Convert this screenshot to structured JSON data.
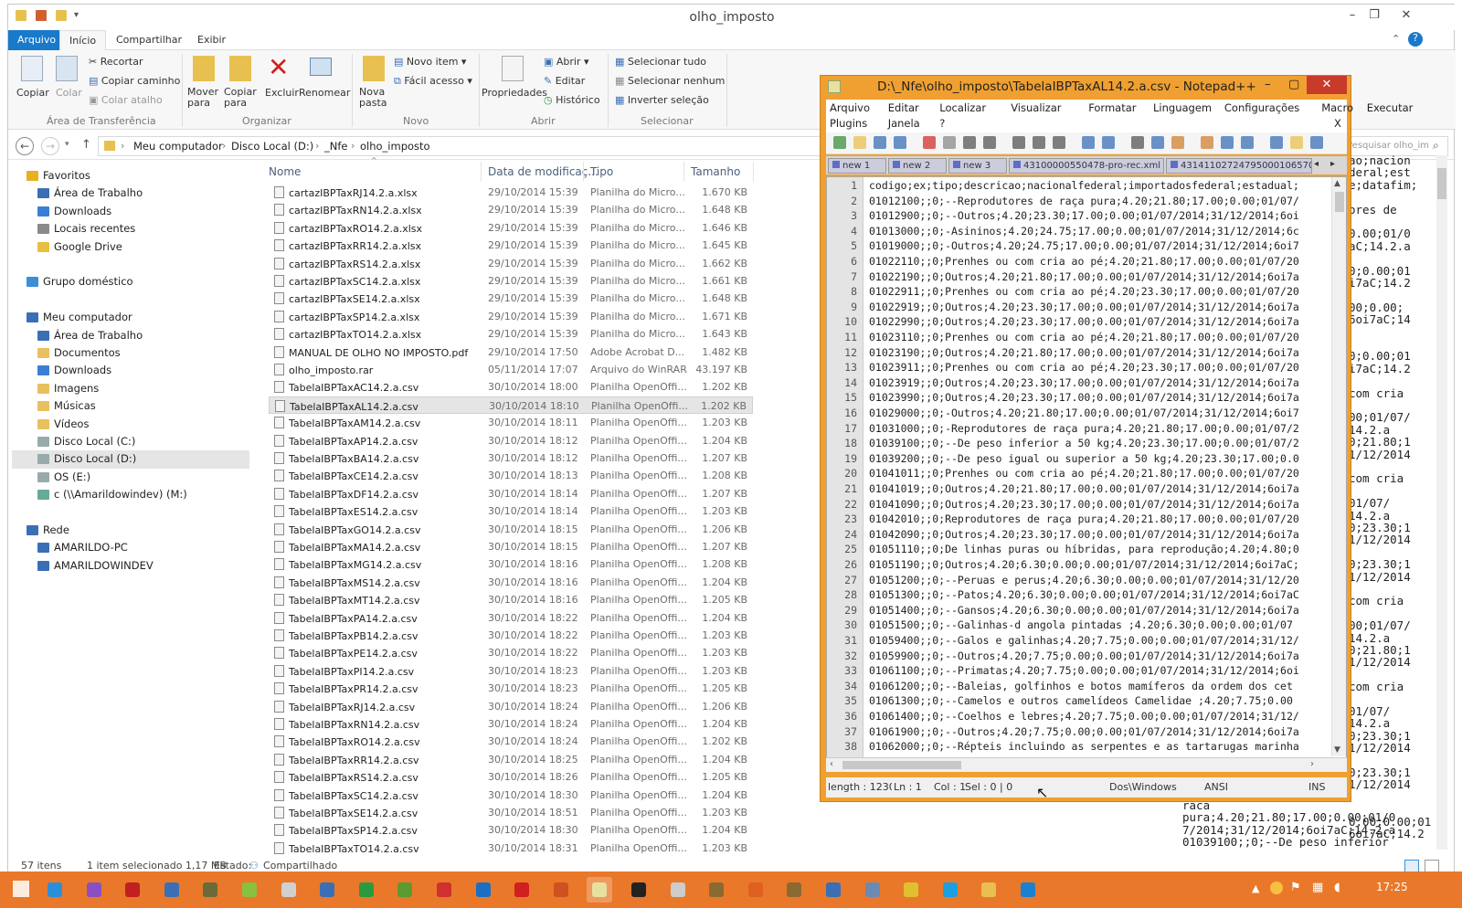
{
  "explorer": {
    "title": "olho_imposto",
    "tabs": [
      "Arquivo",
      "Início",
      "Compartilhar",
      "Exibir"
    ],
    "ribbon": {
      "clipboard": {
        "copiar": "Copiar",
        "colar": "Colar",
        "recortar": "Recortar",
        "copiar_caminho": "Copiar caminho",
        "colar_atalho": "Colar atalho",
        "group": "Área de Transferência"
      },
      "organizar": {
        "mover": "Mover para",
        "copiar_para": "Copiar para",
        "excluir": "Excluir",
        "renomear": "Renomear",
        "group": "Organizar"
      },
      "novo": {
        "nova_pasta": "Nova pasta",
        "novo_item": "Novo item ▾",
        "facil_acesso": "Fácil acesso ▾",
        "group": "Novo"
      },
      "abrir": {
        "propriedades": "Propriedades",
        "abrir": "Abrir ▾",
        "editar": "Editar",
        "historico": "Histórico",
        "group": "Abrir"
      },
      "selecionar": {
        "tudo": "Selecionar tudo",
        "nenhum": "Selecionar nenhum",
        "inverter": "Inverter seleção",
        "group": "Selecionar"
      }
    },
    "address": [
      "Meu computador",
      "Disco Local (D:)",
      "_Nfe",
      "olho_imposto"
    ],
    "search_placeholder": "Pesquisar olho_imposto",
    "nav": [
      {
        "label": "Favoritos",
        "indent": 0,
        "color": "#e8b020",
        "gap": false
      },
      {
        "label": "Área de Trabalho",
        "indent": 1,
        "color": "#3a6fb5",
        "gap": false
      },
      {
        "label": "Downloads",
        "indent": 1,
        "color": "#3a7fd5",
        "gap": false
      },
      {
        "label": "Locais recentes",
        "indent": 1,
        "color": "#8a8a8a",
        "gap": false
      },
      {
        "label": "Google Drive",
        "indent": 1,
        "color": "#e8c040",
        "gap": false
      },
      {
        "label": "Grupo doméstico",
        "indent": 0,
        "color": "#3a8fd5",
        "gap": true
      },
      {
        "label": "Meu computador",
        "indent": 0,
        "color": "#3a6fb5",
        "gap": true
      },
      {
        "label": "Área de Trabalho",
        "indent": 1,
        "color": "#3a6fb5",
        "gap": false
      },
      {
        "label": "Documentos",
        "indent": 1,
        "color": "#e8c060",
        "gap": false
      },
      {
        "label": "Downloads",
        "indent": 1,
        "color": "#3a7fd5",
        "gap": false
      },
      {
        "label": "Imagens",
        "indent": 1,
        "color": "#e8c060",
        "gap": false
      },
      {
        "label": "Músicas",
        "indent": 1,
        "color": "#e8c060",
        "gap": false
      },
      {
        "label": "Vídeos",
        "indent": 1,
        "color": "#e8c060",
        "gap": false
      },
      {
        "label": "Disco Local (C:)",
        "indent": 1,
        "color": "#9aa",
        "gap": false
      },
      {
        "label": "Disco Local (D:)",
        "indent": 1,
        "color": "#9aa",
        "gap": false,
        "sel": true
      },
      {
        "label": "OS (E:)",
        "indent": 1,
        "color": "#9aa",
        "gap": false
      },
      {
        "label": "c (\\\\Amarildowindev) (M:)",
        "indent": 1,
        "color": "#6a9",
        "gap": false
      },
      {
        "label": "Rede",
        "indent": 0,
        "color": "#3a6fb5",
        "gap": true
      },
      {
        "label": "AMARILDO-PC",
        "indent": 1,
        "color": "#3a6fb5",
        "gap": false
      },
      {
        "label": "AMARILDOWINDEV",
        "indent": 1,
        "color": "#3a6fb5",
        "gap": false
      }
    ],
    "columns": {
      "name": "Nome",
      "date": "Data de modificaç...",
      "type": "Tipo",
      "size": "Tamanho"
    },
    "files": [
      [
        "cartazIBPTaxRJ14.2.a.xlsx",
        "29/10/2014 15:39",
        "Planilha do Micro...",
        "1.670 KB"
      ],
      [
        "cartazIBPTaxRN14.2.a.xlsx",
        "29/10/2014 15:39",
        "Planilha do Micro...",
        "1.648 KB"
      ],
      [
        "cartazIBPTaxRO14.2.a.xlsx",
        "29/10/2014 15:39",
        "Planilha do Micro...",
        "1.646 KB"
      ],
      [
        "cartazIBPTaxRR14.2.a.xlsx",
        "29/10/2014 15:39",
        "Planilha do Micro...",
        "1.645 KB"
      ],
      [
        "cartazIBPTaxRS14.2.a.xlsx",
        "29/10/2014 15:39",
        "Planilha do Micro...",
        "1.662 KB"
      ],
      [
        "cartazIBPTaxSC14.2.a.xlsx",
        "29/10/2014 15:39",
        "Planilha do Micro...",
        "1.661 KB"
      ],
      [
        "cartazIBPTaxSE14.2.a.xlsx",
        "29/10/2014 15:39",
        "Planilha do Micro...",
        "1.648 KB"
      ],
      [
        "cartazIBPTaxSP14.2.a.xlsx",
        "29/10/2014 15:39",
        "Planilha do Micro...",
        "1.671 KB"
      ],
      [
        "cartazIBPTaxTO14.2.a.xlsx",
        "29/10/2014 15:39",
        "Planilha do Micro...",
        "1.643 KB"
      ],
      [
        "MANUAL DE OLHO NO IMPOSTO.pdf",
        "29/10/2014 17:50",
        "Adobe Acrobat D...",
        "1.482 KB"
      ],
      [
        "olho_imposto.rar",
        "05/11/2014 17:07",
        "Arquivo do WinRAR",
        "43.197 KB"
      ],
      [
        "TabelaIBPTaxAC14.2.a.csv",
        "30/10/2014 18:00",
        "Planilha OpenOffi...",
        "1.202 KB"
      ],
      [
        "TabelaIBPTaxAL14.2.a.csv",
        "30/10/2014 18:10",
        "Planilha OpenOffi...",
        "1.202 KB"
      ],
      [
        "TabelaIBPTaxAM14.2.a.csv",
        "30/10/2014 18:11",
        "Planilha OpenOffi...",
        "1.203 KB"
      ],
      [
        "TabelaIBPTaxAP14.2.a.csv",
        "30/10/2014 18:12",
        "Planilha OpenOffi...",
        "1.204 KB"
      ],
      [
        "TabelaIBPTaxBA14.2.a.csv",
        "30/10/2014 18:12",
        "Planilha OpenOffi...",
        "1.207 KB"
      ],
      [
        "TabelaIBPTaxCE14.2.a.csv",
        "30/10/2014 18:13",
        "Planilha OpenOffi...",
        "1.208 KB"
      ],
      [
        "TabelaIBPTaxDF14.2.a.csv",
        "30/10/2014 18:14",
        "Planilha OpenOffi...",
        "1.207 KB"
      ],
      [
        "TabelaIBPTaxES14.2.a.csv",
        "30/10/2014 18:14",
        "Planilha OpenOffi...",
        "1.203 KB"
      ],
      [
        "TabelaIBPTaxGO14.2.a.csv",
        "30/10/2014 18:15",
        "Planilha OpenOffi...",
        "1.206 KB"
      ],
      [
        "TabelaIBPTaxMA14.2.a.csv",
        "30/10/2014 18:15",
        "Planilha OpenOffi...",
        "1.207 KB"
      ],
      [
        "TabelaIBPTaxMG14.2.a.csv",
        "30/10/2014 18:16",
        "Planilha OpenOffi...",
        "1.208 KB"
      ],
      [
        "TabelaIBPTaxMS14.2.a.csv",
        "30/10/2014 18:16",
        "Planilha OpenOffi...",
        "1.204 KB"
      ],
      [
        "TabelaIBPTaxMT14.2.a.csv",
        "30/10/2014 18:16",
        "Planilha OpenOffi...",
        "1.205 KB"
      ],
      [
        "TabelaIBPTaxPA14.2.a.csv",
        "30/10/2014 18:22",
        "Planilha OpenOffi...",
        "1.204 KB"
      ],
      [
        "TabelaIBPTaxPB14.2.a.csv",
        "30/10/2014 18:22",
        "Planilha OpenOffi...",
        "1.203 KB"
      ],
      [
        "TabelaIBPTaxPE14.2.a.csv",
        "30/10/2014 18:22",
        "Planilha OpenOffi...",
        "1.203 KB"
      ],
      [
        "TabelaIBPTaxPI14.2.a.csv",
        "30/10/2014 18:23",
        "Planilha OpenOffi...",
        "1.203 KB"
      ],
      [
        "TabelaIBPTaxPR14.2.a.csv",
        "30/10/2014 18:23",
        "Planilha OpenOffi...",
        "1.205 KB"
      ],
      [
        "TabelaIBPTaxRJ14.2.a.csv",
        "30/10/2014 18:24",
        "Planilha OpenOffi...",
        "1.206 KB"
      ],
      [
        "TabelaIBPTaxRN14.2.a.csv",
        "30/10/2014 18:24",
        "Planilha OpenOffi...",
        "1.204 KB"
      ],
      [
        "TabelaIBPTaxRO14.2.a.csv",
        "30/10/2014 18:24",
        "Planilha OpenOffi...",
        "1.202 KB"
      ],
      [
        "TabelaIBPTaxRR14.2.a.csv",
        "30/10/2014 18:25",
        "Planilha OpenOffi...",
        "1.204 KB"
      ],
      [
        "TabelaIBPTaxRS14.2.a.csv",
        "30/10/2014 18:26",
        "Planilha OpenOffi...",
        "1.205 KB"
      ],
      [
        "TabelaIBPTaxSC14.2.a.csv",
        "30/10/2014 18:30",
        "Planilha OpenOffi...",
        "1.204 KB"
      ],
      [
        "TabelaIBPTaxSE14.2.a.csv",
        "30/10/2014 18:51",
        "Planilha OpenOffi...",
        "1.203 KB"
      ],
      [
        "TabelaIBPTaxSP14.2.a.csv",
        "30/10/2014 18:30",
        "Planilha OpenOffi...",
        "1.204 KB"
      ],
      [
        "TabelaIBPTaxTO14.2.a.csv",
        "30/10/2014 18:31",
        "Planilha OpenOffi...",
        "1.203 KB"
      ]
    ],
    "selected_index": 12,
    "status": {
      "count": "57 itens",
      "selected": "1 item selecionado  1,17 MB",
      "state_label": "Estado:",
      "state": "Compartilhado"
    }
  },
  "background_text": [
    "ao;nacion",
    "deral;est",
    "e;datafim;",
    "",
    "ores de",
    "",
    "0.00;01/0",
    "aC;14.2.a",
    "",
    "0;0.00;01",
    "i7aC;14.2",
    "",
    "00;0.00;",
    "6oi7aC;14",
    "",
    "",
    "0;0.00;01",
    "i7aC;14.2",
    "",
    "com cria",
    "",
    "00;01/07/",
    "14.2.a",
    "0;21.80;1",
    "1/12/2014",
    "",
    "com cria",
    "",
    "01/07/",
    "14.2.a",
    "0;23.30;1",
    "1/12/2014",
    "",
    "0;23.30;1",
    "1/12/2014",
    "",
    "com cria",
    "",
    "00;01/07/",
    "14.2.a",
    "0;21.80;1",
    "1/12/2014",
    "",
    "com cria",
    "",
    "01/07/",
    "14.2.a",
    "0;23.30;1",
    "1/12/2014",
    "",
    "0;23.30;1",
    "1/12/2014",
    "",
    "",
    "0.00;0.00;01",
    "6oi7aC;14.2"
  ],
  "background_tail": [
    "raca",
    "pura;4.20;21.80;17.00;0.00;01/0",
    "7/2014;31/12/2014;6oi7aC;14.2.a",
    "01039100;;0;--De peso inferior"
  ],
  "npp": {
    "title": "D:\\_Nfe\\olho_imposto\\TabelaIBPTaxAL14.2.a.csv - Notepad++",
    "menu1": [
      "Arquivo",
      "Editar",
      "Localizar",
      "Visualizar",
      "Formatar",
      "Linguagem",
      "Configurações",
      "Macro",
      "Executar"
    ],
    "menu2": [
      "Plugins",
      "Janela",
      "?"
    ],
    "close_x": "X",
    "tabs": [
      "new 1",
      "new 2",
      "new 3",
      "43100000550478-pro-rec.xml",
      "43141102724795000106570010"
    ],
    "lines": [
      "codigo;ex;tipo;descricao;nacionalfederal;importadosfederal;estadual;",
      "01012100;;0;--Reprodutores de raça pura;4.20;21.80;17.00;0.00;01/07/",
      "01012900;;0;--Outros;4.20;23.30;17.00;0.00;01/07/2014;31/12/2014;6oi",
      "01013000;;0;-Asininos;4.20;24.75;17.00;0.00;01/07/2014;31/12/2014;6c",
      "01019000;;0;-Outros;4.20;24.75;17.00;0.00;01/07/2014;31/12/2014;6oi7",
      "01022110;;0;Prenhes ou com cria ao pé;4.20;21.80;17.00;0.00;01/07/20",
      "01022190;;0;Outros;4.20;21.80;17.00;0.00;01/07/2014;31/12/2014;6oi7a",
      "01022911;;0;Prenhes ou com cria ao pé;4.20;23.30;17.00;0.00;01/07/20",
      "01022919;;0;Outros;4.20;23.30;17.00;0.00;01/07/2014;31/12/2014;6oi7a",
      "01022990;;0;Outros;4.20;23.30;17.00;0.00;01/07/2014;31/12/2014;6oi7a",
      "01023110;;0;Prenhes ou com cria ao pé;4.20;21.80;17.00;0.00;01/07/20",
      "01023190;;0;Outros;4.20;21.80;17.00;0.00;01/07/2014;31/12/2014;6oi7a",
      "01023911;;0;Prenhes ou com cria ao pé;4.20;23.30;17.00;0.00;01/07/20",
      "01023919;;0;Outros;4.20;23.30;17.00;0.00;01/07/2014;31/12/2014;6oi7a",
      "01023990;;0;Outros;4.20;23.30;17.00;0.00;01/07/2014;31/12/2014;6oi7a",
      "01029000;;0;-Outros;4.20;21.80;17.00;0.00;01/07/2014;31/12/2014;6oi7",
      "01031000;;0;-Reprodutores de raça pura;4.20;21.80;17.00;0.00;01/07/2",
      "01039100;;0;--De peso inferior a 50 kg;4.20;23.30;17.00;0.00;01/07/2",
      "01039200;;0;--De peso igual ou superior a 50 kg;4.20;23.30;17.00;0.0",
      "01041011;;0;Prenhes ou com cria ao pé;4.20;21.80;17.00;0.00;01/07/20",
      "01041019;;0;Outros;4.20;21.80;17.00;0.00;01/07/2014;31/12/2014;6oi7a",
      "01041090;;0;Outros;4.20;23.30;17.00;0.00;01/07/2014;31/12/2014;6oi7a",
      "01042010;;0;Reprodutores de raça pura;4.20;21.80;17.00;0.00;01/07/20",
      "01042090;;0;Outros;4.20;23.30;17.00;0.00;01/07/2014;31/12/2014;6oi7a",
      "01051110;;0;De linhas puras ou híbridas, para reprodução;4.20;4.80;0",
      "01051190;;0;Outros;4.20;6.30;0.00;0.00;01/07/2014;31/12/2014;6oi7aC;",
      "01051200;;0;--Peruas e perus;4.20;6.30;0.00;0.00;01/07/2014;31/12/20",
      "01051300;;0;--Patos;4.20;6.30;0.00;0.00;01/07/2014;31/12/2014;6oi7aC",
      "01051400;;0;--Gansos;4.20;6.30;0.00;0.00;01/07/2014;31/12/2014;6oi7a",
      "01051500;;0;--Galinhas-d angola  pintadas ;4.20;6.30;0.00;0.00;01/07",
      "01059400;;0;--Galos e galinhas;4.20;7.75;0.00;0.00;01/07/2014;31/12/",
      "01059900;;0;--Outros;4.20;7.75;0.00;0.00;01/07/2014;31/12/2014;6oi7a",
      "01061100;;0;--Primatas;4.20;7.75;0.00;0.00;01/07/2014;31/12/2014;6oi",
      "01061200;;0;--Baleias, golfinhos e botos  mamíferos da ordem dos cet",
      "01061300;;0;--Camelos e outros camelídeos  Camelidae ;4.20;7.75;0.00",
      "01061400;;0;--Coelhos e lebres;4.20;7.75;0.00;0.00;01/07/2014;31/12/",
      "01061900;;0;--Outros;4.20;7.75;0.00;0.00;01/07/2014;31/12/2014;6oi7a",
      "01062000;;0;--Répteis  incluindo as serpentes e as tartarugas marinha"
    ],
    "status": {
      "length": "length : 1230€",
      "ln": "Ln : 1",
      "col": "Col : 1",
      "sel": "Sel : 0 | 0",
      "eol": "Dos\\Windows",
      "enc": "ANSI",
      "ins": "INS"
    }
  },
  "taskbar": {
    "clock": "17:25",
    "apps": [
      {
        "name": "ie",
        "color": "#2a8fd8"
      },
      {
        "name": "vs",
        "color": "#8a4fc0"
      },
      {
        "name": "filezilla",
        "color": "#c02020"
      },
      {
        "name": "app4",
        "color": "#3a6fb5"
      },
      {
        "name": "app5",
        "color": "#6a6a3a"
      },
      {
        "name": "app6",
        "color": "#8ac040"
      },
      {
        "name": "app7",
        "color": "#d0d0d0"
      },
      {
        "name": "app8",
        "color": "#3a6fb5"
      },
      {
        "name": "app9",
        "color": "#2a9a40"
      },
      {
        "name": "app10",
        "color": "#5a9a30"
      },
      {
        "name": "app11",
        "color": "#d03030"
      },
      {
        "name": "app12",
        "color": "#1a6fc5"
      },
      {
        "name": "opera",
        "color": "#d02020"
      },
      {
        "name": "app14",
        "color": "#d05020"
      },
      {
        "name": "notepadpp",
        "color": "#e8e0a0"
      },
      {
        "name": "cmd",
        "color": "#222"
      },
      {
        "name": "app17",
        "color": "#ccc"
      },
      {
        "name": "app18",
        "color": "#8a6a30"
      },
      {
        "name": "firefox",
        "color": "#e06020"
      },
      {
        "name": "app20",
        "color": "#8a6a30"
      },
      {
        "name": "app21",
        "color": "#3a6fb5"
      },
      {
        "name": "app22",
        "color": "#6a8ab5"
      },
      {
        "name": "chrome",
        "color": "#e0c030"
      },
      {
        "name": "skype",
        "color": "#1aa0e0"
      },
      {
        "name": "explorer",
        "color": "#e8c050"
      },
      {
        "name": "app26",
        "color": "#1a80d0"
      }
    ]
  }
}
